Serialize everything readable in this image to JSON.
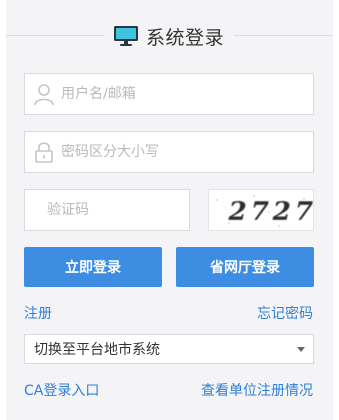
{
  "header": {
    "title": "系统登录",
    "icon": "monitor-icon"
  },
  "form": {
    "username_placeholder": "用户名/邮箱",
    "password_placeholder": "密码区分大小写",
    "captcha_placeholder": "验证码",
    "captcha_text": "2727"
  },
  "buttons": {
    "login": "立即登录",
    "province_login": "省网厅登录"
  },
  "links": {
    "register": "注册",
    "forgot_password": "忘记密码",
    "ca_login": "CA登录入口",
    "check_unit": "查看单位注册情况"
  },
  "platform_select": {
    "selected": "切换至平台地市系统"
  },
  "colors": {
    "accent": "#3d8ee3",
    "link": "#2e7fd6",
    "panel_bg": "#f4f4f6"
  }
}
